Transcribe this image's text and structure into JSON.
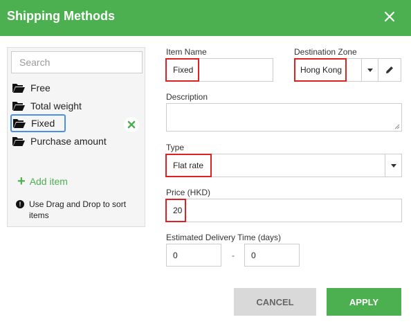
{
  "dialog": {
    "title": "Shipping Methods"
  },
  "sidebar": {
    "search_placeholder": "Search",
    "items": [
      {
        "label": "Free"
      },
      {
        "label": "Total weight"
      },
      {
        "label": "Fixed",
        "selected": true
      },
      {
        "label": "Purchase amount"
      }
    ],
    "add_item_label": "Add item",
    "hint": "Use Drag and Drop to sort items"
  },
  "form": {
    "item_name_label": "Item Name",
    "item_name_value": "Fixed",
    "destination_zone_label": "Destination Zone",
    "destination_zone_value": "Hong Kong",
    "description_label": "Description",
    "description_value": "",
    "type_label": "Type",
    "type_value": "Flat rate",
    "price_label": "Price (HKD)",
    "price_value": "20",
    "delivery_label": "Estimated Delivery Time (days)",
    "delivery_min": "0",
    "delivery_separator": "-",
    "delivery_max": "0"
  },
  "buttons": {
    "cancel": "CANCEL",
    "apply": "APPLY"
  },
  "colors": {
    "header": "#4caf50",
    "highlight": "#e02020",
    "selection": "#4a90e2",
    "remove_icon": "#4caf50"
  }
}
